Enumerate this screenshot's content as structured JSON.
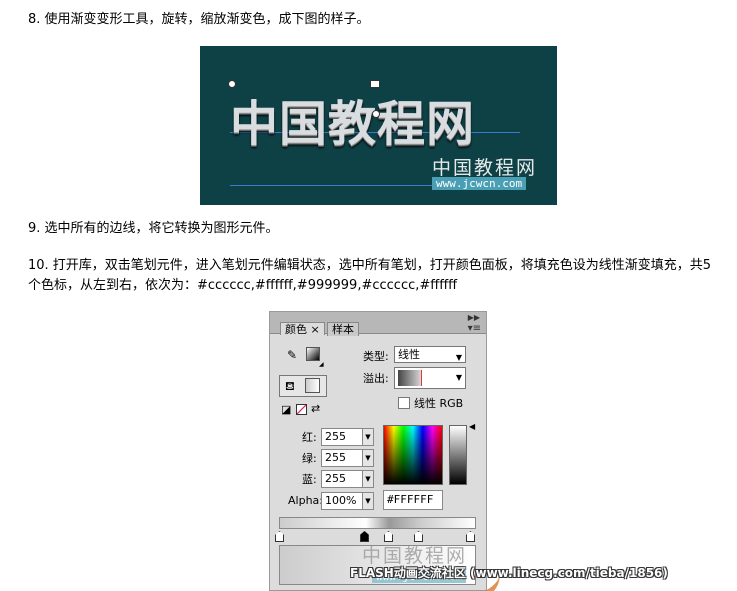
{
  "steps": {
    "step8": "8. 使用渐变变形工具，旋转，缩放渐变色，成下图的样子。",
    "step9": "9. 选中所有的边线，将它转换为图形元件。",
    "step10": "10. 打开库，双击笔划元件，进入笔划元件编辑状态，选中所有笔划，打开颜色面板，将填充色设为线性渐变填充，共5个色标，从左到右，依次为：#cccccc,#ffffff,#999999,#cccccc,#ffffff"
  },
  "banner": {
    "title": "中国教程网",
    "watermark_cn": "中国教程网",
    "watermark_url": "www.jcwcn.com",
    "background": "#0e4146"
  },
  "panel": {
    "tabs": [
      {
        "label": "颜色 ×"
      },
      {
        "label": "样本"
      }
    ],
    "collapse_icon": "double-right-arrow",
    "menu_icon": "panel-menu",
    "type_label": "类型:",
    "type_value": "线性",
    "overflow_label": "溢出:",
    "linear_rgb_label": "线性 RGB",
    "linear_rgb_checked": false,
    "red_label": "红:",
    "red_value": "255",
    "green_label": "绿:",
    "green_value": "255",
    "blue_label": "蓝:",
    "blue_value": "255",
    "alpha_label": "Alpha:",
    "alpha_value": "100%",
    "hex_value": "#FFFFFF",
    "gradient_stops": [
      "#cccccc",
      "#ffffff",
      "#999999",
      "#cccccc",
      "#ffffff"
    ],
    "selected_stop": 1
  },
  "watermark": {
    "cn": "中国教程网",
    "url": "www.jcwcn.com",
    "footer": "FLASH动画交流社区 (www.linecg.com/tieba/1856)"
  }
}
